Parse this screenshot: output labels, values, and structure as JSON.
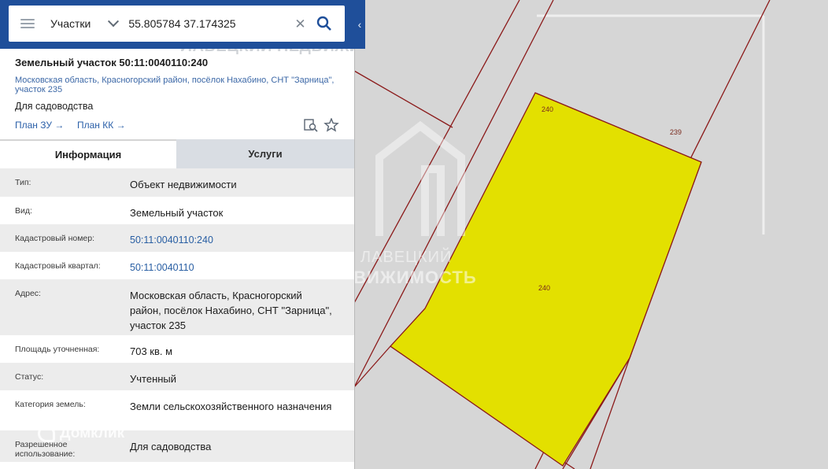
{
  "search": {
    "type_label": "Участки",
    "value": "55.805784 37.174325"
  },
  "card": {
    "title": "Земельный участок 50:11:0040110:240",
    "address_short": "Московская область, Красногорский район, посёлок Нахабино, СНТ \"Зарница\", участок 235",
    "usage": "Для садоводства",
    "links": [
      "План ЗУ →",
      "План КК →"
    ]
  },
  "tabs": [
    "Информация",
    "Услуги"
  ],
  "info_rows": [
    {
      "key": "Тип:",
      "value": "Объект недвижимости"
    },
    {
      "key": "Вид:",
      "value": "Земельный участок"
    },
    {
      "key": "Кадастровый номер:",
      "value": "50:11:0040110:240"
    },
    {
      "key": "Кадастровый квартал:",
      "value": "50:11:0040110"
    },
    {
      "key": "Адрес:",
      "value": "Московская область, Красногорский район, посёлок Нахабино, СНТ \"Зарница\", участок 235"
    },
    {
      "key": "Площадь уточненная:",
      "value": "703 кв. м"
    },
    {
      "key": "Статус:",
      "value": "Учтенный"
    },
    {
      "key": "Категория земель:",
      "value": "Земли сельскохозяйственного назначения"
    },
    {
      "key": "Разрешенное использование:",
      "value": "Для садоводства"
    }
  ],
  "map": {
    "parcel_labels": [
      "240",
      "239",
      "240"
    ],
    "parcel_color": "#e3e000",
    "boundary_color": "#8b1a1a"
  },
  "watermarks": {
    "top": "ЛАВЕЦКИЙ НЕДВИЖИМОСТЬ",
    "center_line1": "ЛАВЕЦКИЙ",
    "center_line2": "НЕДВИЖИМОСТЬ",
    "corner": "Домклик"
  }
}
